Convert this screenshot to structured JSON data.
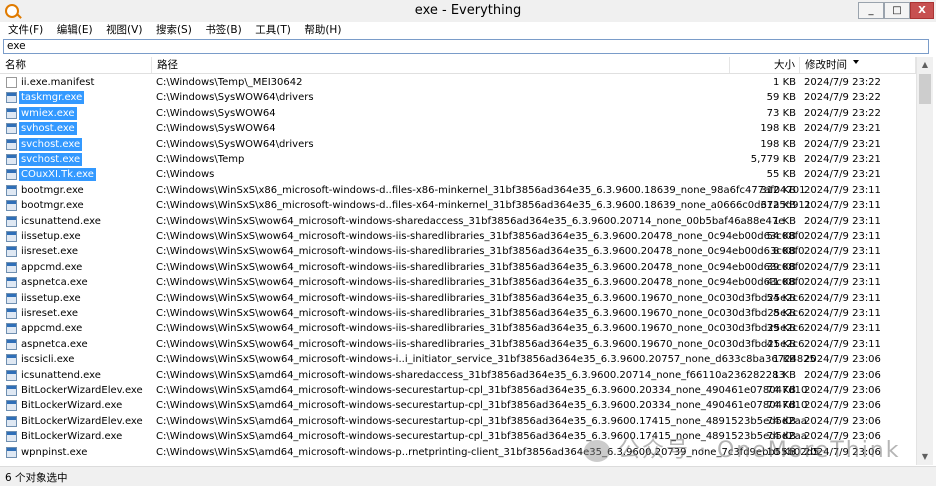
{
  "window": {
    "title": "exe - Everything",
    "min_label": "_",
    "max_label": "□",
    "close_label": "X"
  },
  "menu": [
    "文件(F)",
    "编辑(E)",
    "视图(V)",
    "搜索(S)",
    "书签(B)",
    "工具(T)",
    "帮助(H)"
  ],
  "search": {
    "value": "exe"
  },
  "columns": {
    "name": "名称",
    "path": "路径",
    "size": "大小",
    "date": "修改时间"
  },
  "scrollbar": {
    "up": "▲",
    "down": "▼"
  },
  "rows": [
    {
      "name": "ii.exe.manifest",
      "path": "C:\\Windows\\Temp\\_MEI30642",
      "size": "1 KB",
      "date": "2024/7/9 23:22",
      "selected": false,
      "icon": "doc"
    },
    {
      "name": "taskmgr.exe",
      "path": "C:\\Windows\\SysWOW64\\drivers",
      "size": "59 KB",
      "date": "2024/7/9 23:22",
      "selected": true,
      "icon": "exe"
    },
    {
      "name": "wmiex.exe",
      "path": "C:\\Windows\\SysWOW64",
      "size": "73 KB",
      "date": "2024/7/9 23:22",
      "selected": true,
      "icon": "exe"
    },
    {
      "name": "svhost.exe",
      "path": "C:\\Windows\\SysWOW64",
      "size": "198 KB",
      "date": "2024/7/9 23:21",
      "selected": true,
      "icon": "exe"
    },
    {
      "name": "svchost.exe",
      "path": "C:\\Windows\\SysWOW64\\drivers",
      "size": "198 KB",
      "date": "2024/7/9 23:21",
      "selected": true,
      "icon": "exe"
    },
    {
      "name": "svchost.exe",
      "path": "C:\\Windows\\Temp",
      "size": "5,779 KB",
      "date": "2024/7/9 23:21",
      "selected": true,
      "icon": "exe"
    },
    {
      "name": "COuxXI.Tk.exe",
      "path": "C:\\Windows",
      "size": "55 KB",
      "date": "2024/7/9 23:21",
      "selected": true,
      "icon": "exe"
    },
    {
      "name": "bootmgr.exe",
      "path": "C:\\Windows\\WinSxS\\x86_microsoft-windows-d..files-x86-minkernel_31bf3856ad364e35_6.3.9600.18639_none_98a6fc477af04701",
      "size": "312 KB",
      "date": "2024/7/9 23:11",
      "selected": false,
      "icon": "exe"
    },
    {
      "name": "bootmgr.exe",
      "path": "C:\\Windows\\WinSxS\\x86_microsoft-windows-d..files-x64-minkernel_31bf3856ad364e35_6.3.9600.18639_none_a0666c0d67a5d911",
      "size": "312 KB",
      "date": "2024/7/9 23:11",
      "selected": false,
      "icon": "exe"
    },
    {
      "name": "icsunattend.exe",
      "path": "C:\\Windows\\WinSxS\\wow64_microsoft-windows-sharedaccess_31bf3856ad364e35_6.3.9600.20714_none_00b5baf46a88e47e",
      "size": "1 KB",
      "date": "2024/7/9 23:11",
      "selected": false,
      "icon": "exe"
    },
    {
      "name": "iissetup.exe",
      "path": "C:\\Windows\\WinSxS\\wow64_microsoft-windows-iis-sharedlibraries_31bf3856ad364e35_6.3.9600.20478_none_0c94eb00d63c08f0",
      "size": "54 KB",
      "date": "2024/7/9 23:11",
      "selected": false,
      "icon": "exe"
    },
    {
      "name": "iisreset.exe",
      "path": "C:\\Windows\\WinSxS\\wow64_microsoft-windows-iis-sharedlibraries_31bf3856ad364e35_6.3.9600.20478_none_0c94eb00d63c08f0",
      "size": "8 KB",
      "date": "2024/7/9 23:11",
      "selected": false,
      "icon": "exe"
    },
    {
      "name": "appcmd.exe",
      "path": "C:\\Windows\\WinSxS\\wow64_microsoft-windows-iis-sharedlibraries_31bf3856ad364e35_6.3.9600.20478_none_0c94eb00d63c08f0",
      "size": "39 KB",
      "date": "2024/7/9 23:11",
      "selected": false,
      "icon": "exe"
    },
    {
      "name": "aspnetca.exe",
      "path": "C:\\Windows\\WinSxS\\wow64_microsoft-windows-iis-sharedlibraries_31bf3856ad364e35_6.3.9600.20478_none_0c94eb00d63c08f0",
      "size": "41 KB",
      "date": "2024/7/9 23:11",
      "selected": false,
      "icon": "exe"
    },
    {
      "name": "iissetup.exe",
      "path": "C:\\Windows\\WinSxS\\wow64_microsoft-windows-iis-sharedlibraries_31bf3856ad364e35_6.3.9600.19670_none_0c030d3fbd25e2c6",
      "size": "54 KB",
      "date": "2024/7/9 23:11",
      "selected": false,
      "icon": "exe"
    },
    {
      "name": "iisreset.exe",
      "path": "C:\\Windows\\WinSxS\\wow64_microsoft-windows-iis-sharedlibraries_31bf3856ad364e35_6.3.9600.19670_none_0c030d3fbd25e2c6",
      "size": "8 KB",
      "date": "2024/7/9 23:11",
      "selected": false,
      "icon": "exe"
    },
    {
      "name": "appcmd.exe",
      "path": "C:\\Windows\\WinSxS\\wow64_microsoft-windows-iis-sharedlibraries_31bf3856ad364e35_6.3.9600.19670_none_0c030d3fbd25e2c6",
      "size": "39 KB",
      "date": "2024/7/9 23:11",
      "selected": false,
      "icon": "exe"
    },
    {
      "name": "aspnetca.exe",
      "path": "C:\\Windows\\WinSxS\\wow64_microsoft-windows-iis-sharedlibraries_31bf3856ad364e35_6.3.9600.19670_none_0c030d3fbd25e2c6",
      "size": "41 KB",
      "date": "2024/7/9 23:11",
      "selected": false,
      "icon": "exe"
    },
    {
      "name": "iscsicli.exe",
      "path": "C:\\Windows\\WinSxS\\wow64_microsoft-windows-i..i_initiator_service_31bf3856ad364e35_6.3.9600.20757_none_d633c8ba36724825",
      "size": "1 KB",
      "date": "2024/7/9 23:06",
      "selected": false,
      "icon": "exe"
    },
    {
      "name": "icsunattend.exe",
      "path": "C:\\Windows\\WinSxS\\amd64_microsoft-windows-sharedaccess_31bf3856ad364e35_6.3.9600.20714_none_f66110a236282283",
      "size": "1 KB",
      "date": "2024/7/9 23:06",
      "selected": false,
      "icon": "exe"
    },
    {
      "name": "BitLockerWizardElev.exe",
      "path": "C:\\Windows\\WinSxS\\amd64_microsoft-windows-securestartup-cpl_31bf3856ad364e35_6.3.9600.20334_none_490461e078047d10",
      "size": "74 KB",
      "date": "2024/7/9 23:06",
      "selected": false,
      "icon": "exe"
    },
    {
      "name": "BitLockerWizard.exe",
      "path": "C:\\Windows\\WinSxS\\amd64_microsoft-windows-securestartup-cpl_31bf3856ad364e35_6.3.9600.20334_none_490461e078047d10",
      "size": "74 KB",
      "date": "2024/7/9 23:06",
      "selected": false,
      "icon": "exe"
    },
    {
      "name": "BitLockerWizardElev.exe",
      "path": "C:\\Windows\\WinSxS\\amd64_microsoft-windows-securestartup-cpl_31bf3856ad364e35_6.3.9600.17415_none_4891523b5ed5d2aa",
      "size": "74 KB",
      "date": "2024/7/9 23:06",
      "selected": false,
      "icon": "exe"
    },
    {
      "name": "BitLockerWizard.exe",
      "path": "C:\\Windows\\WinSxS\\amd64_microsoft-windows-securestartup-cpl_31bf3856ad364e35_6.3.9600.17415_none_4891523b5ed5d2aa",
      "size": "74 KB",
      "date": "2024/7/9 23:06",
      "selected": false,
      "icon": "exe"
    },
    {
      "name": "wpnpinst.exe",
      "path": "C:\\Windows\\WinSxS\\amd64_microsoft-windows-p..rnetprinting-client_31bf3856ad364e35_6.3.9600.20739_none_7c3fd9ebb55b02d5",
      "size": "10 KB",
      "date": "2024/7/9 23:06",
      "selected": false,
      "icon": "exe"
    }
  ],
  "status": {
    "text": "6 个对象选中"
  },
  "watermark": {
    "text": "公众号 · OneMoreThink"
  },
  "colors": {
    "selection": "#3399ff",
    "close_button": "#c75050",
    "app_icon": "#e07b00"
  }
}
